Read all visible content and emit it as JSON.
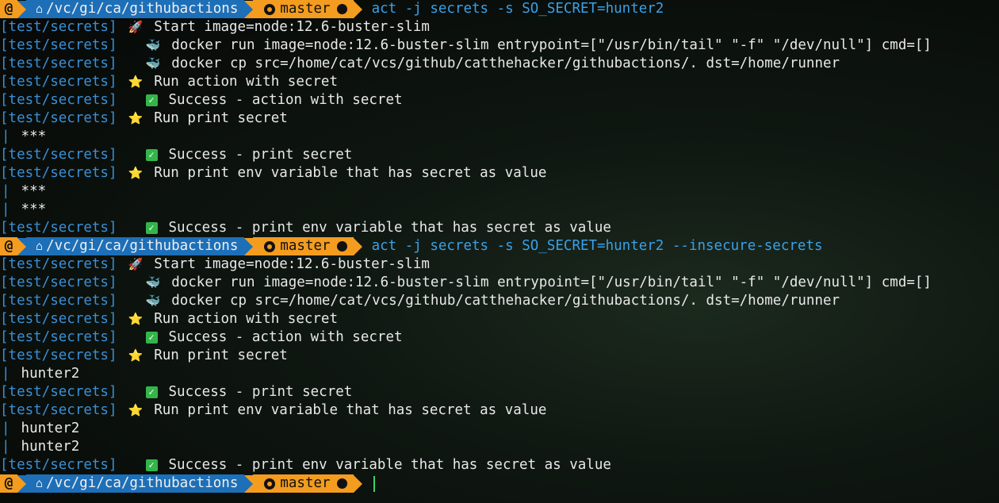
{
  "prompt": {
    "logo": "@",
    "path": "/vc/gi/ca/githubactions",
    "branch": "master"
  },
  "commands": [
    "act -j secrets -s SO_SECRET=hunter2",
    "act -j secrets -s SO_SECRET=hunter2 --insecure-secrets"
  ],
  "job_tag": "[test/secrets]",
  "runs": [
    {
      "lines": [
        {
          "type": "step",
          "icon": "rocket-icon",
          "indent": 1,
          "text": "Start image=node:12.6-buster-slim"
        },
        {
          "type": "step",
          "icon": "docker-icon",
          "indent": 2,
          "text": "docker run image=node:12.6-buster-slim entrypoint=[\"/usr/bin/tail\" \"-f\" \"/dev/null\"] cmd=[]"
        },
        {
          "type": "step",
          "icon": "docker-icon",
          "indent": 2,
          "text": "docker cp src=/home/cat/vcs/github/catthehacker/githubactions/. dst=/home/runner"
        },
        {
          "type": "step",
          "icon": "star-icon",
          "indent": 1,
          "text": "Run action with secret"
        },
        {
          "type": "step",
          "icon": "check-icon",
          "indent": 2,
          "text": "Success - action with secret"
        },
        {
          "type": "step",
          "icon": "star-icon",
          "indent": 1,
          "text": "Run print secret"
        },
        {
          "type": "output",
          "text": "***"
        },
        {
          "type": "step",
          "icon": "check-icon",
          "indent": 2,
          "text": "Success - print secret"
        },
        {
          "type": "step",
          "icon": "star-icon",
          "indent": 1,
          "text": "Run print env variable that has secret as value"
        },
        {
          "type": "output",
          "text": "***"
        },
        {
          "type": "output",
          "text": "***"
        },
        {
          "type": "step",
          "icon": "check-icon",
          "indent": 2,
          "text": "Success - print env variable that has secret as value"
        }
      ]
    },
    {
      "lines": [
        {
          "type": "step",
          "icon": "rocket-icon",
          "indent": 1,
          "text": "Start image=node:12.6-buster-slim"
        },
        {
          "type": "step",
          "icon": "docker-icon",
          "indent": 2,
          "text": "docker run image=node:12.6-buster-slim entrypoint=[\"/usr/bin/tail\" \"-f\" \"/dev/null\"] cmd=[]"
        },
        {
          "type": "step",
          "icon": "docker-icon",
          "indent": 2,
          "text": "docker cp src=/home/cat/vcs/github/catthehacker/githubactions/. dst=/home/runner"
        },
        {
          "type": "step",
          "icon": "star-icon",
          "indent": 1,
          "text": "Run action with secret"
        },
        {
          "type": "step",
          "icon": "check-icon",
          "indent": 2,
          "text": "Success - action with secret"
        },
        {
          "type": "step",
          "icon": "star-icon",
          "indent": 1,
          "text": "Run print secret"
        },
        {
          "type": "output",
          "text": "hunter2"
        },
        {
          "type": "step",
          "icon": "check-icon",
          "indent": 2,
          "text": "Success - print secret"
        },
        {
          "type": "step",
          "icon": "star-icon",
          "indent": 1,
          "text": "Run print env variable that has secret as value"
        },
        {
          "type": "output",
          "text": "hunter2"
        },
        {
          "type": "output",
          "text": "hunter2"
        },
        {
          "type": "step",
          "icon": "check-icon",
          "indent": 2,
          "text": "Success - print env variable that has secret as value"
        }
      ]
    }
  ],
  "icons": {
    "rocket-icon": "🚀",
    "docker-icon": "🐳",
    "star-icon": "⭐",
    "check-icon": "✓"
  },
  "colors": {
    "tag": "#3a8fd6",
    "command": "#3aa0e8",
    "prompt_orange": "#f39c1f",
    "prompt_blue": "#1d6fb8",
    "success_green": "#33b54a"
  }
}
